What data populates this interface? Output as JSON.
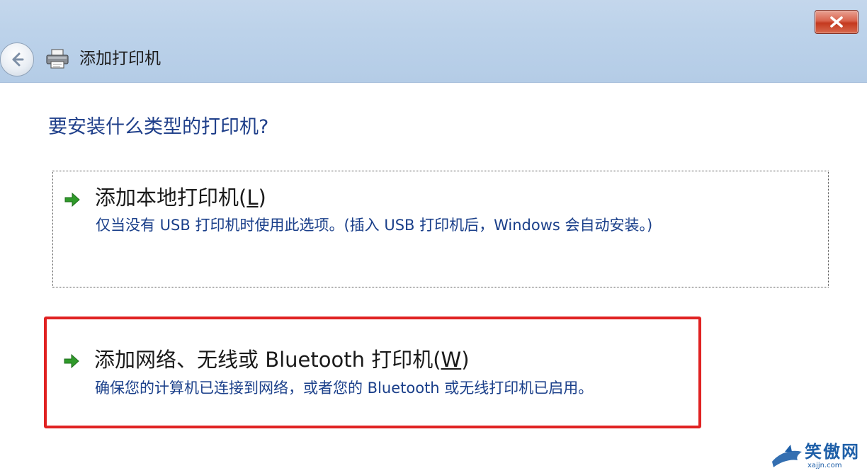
{
  "window": {
    "title": "添加打印机",
    "close_label": "关闭"
  },
  "main": {
    "heading": "要安装什么类型的打印机?"
  },
  "options": [
    {
      "title_prefix": "添加本地打印机(",
      "title_key": "L",
      "title_suffix": ")",
      "description": "仅当没有 USB 打印机时使用此选项。(插入 USB 打印机后，Windows 会自动安装。)"
    },
    {
      "title_prefix": "添加网络、无线或 Bluetooth 打印机(",
      "title_key": "W",
      "title_suffix": ")",
      "description": "确保您的计算机已连接到网络，或者您的 Bluetooth 或无线打印机已启用。"
    }
  ],
  "watermark": {
    "text": "笑傲网",
    "url": "xajjn.com"
  },
  "colors": {
    "heading": "#1f3f8a",
    "description": "#1a3f8a",
    "arrow": "#2f9a2a",
    "highlight": "#e02222",
    "titlebar": "#bcd2ea"
  },
  "icons": {
    "back": "back-arrow-icon",
    "printer": "printer-icon",
    "close": "close-icon",
    "option_arrow": "green-arrow-icon"
  }
}
